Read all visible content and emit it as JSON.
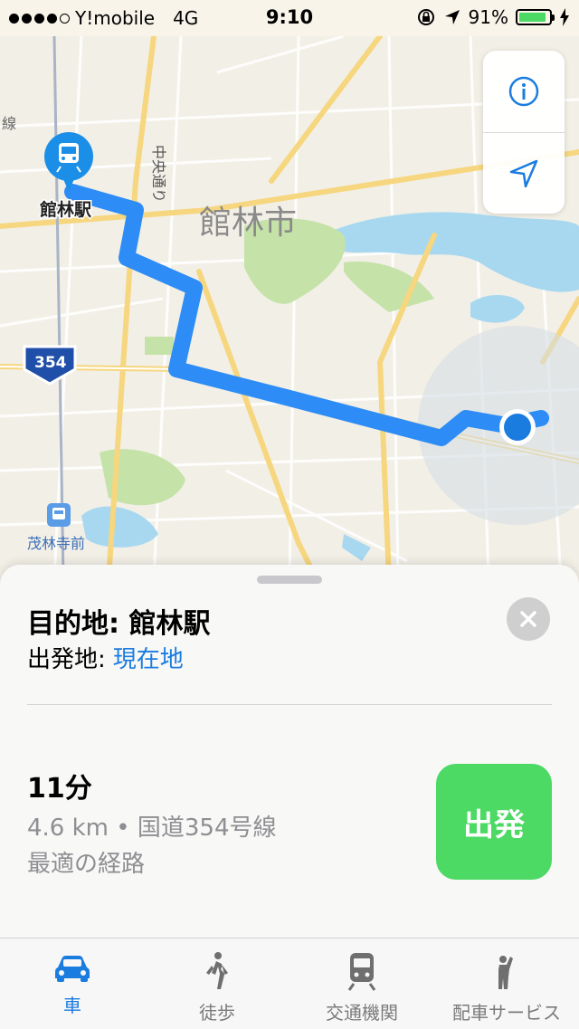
{
  "status": {
    "carrier": "Y!mobile",
    "network": "4G",
    "time": "9:10",
    "battery": "91%",
    "battery_level": 0.91
  },
  "map": {
    "city_label": "館林市",
    "station_label": "館林駅",
    "station2_label": "茂林寺前",
    "road_label": "中央通り",
    "route_shield": "354",
    "line_label": "線"
  },
  "controls": {
    "info_icon": "info-icon",
    "location_icon": "location-arrow-icon"
  },
  "sheet": {
    "destination_prefix": "目的地:",
    "destination": "館林駅",
    "origin_prefix": "出発地:",
    "origin": "現在地",
    "duration": "11分",
    "distance": "4.6 km",
    "route_name": "国道354号線",
    "route_note": "最適の経路",
    "go_label": "出発"
  },
  "tabs": [
    {
      "label": "車",
      "icon": "car-icon",
      "active": true
    },
    {
      "label": "徒歩",
      "icon": "walking-icon",
      "active": false
    },
    {
      "label": "交通機関",
      "icon": "train-icon",
      "active": false
    },
    {
      "label": "配車サービス",
      "icon": "hail-icon",
      "active": false
    }
  ],
  "colors": {
    "accent": "#1b7ce0",
    "route": "#2d8cf5",
    "go_button": "#4cd964",
    "water": "#a8d8f0",
    "park": "#c5e2a8"
  }
}
